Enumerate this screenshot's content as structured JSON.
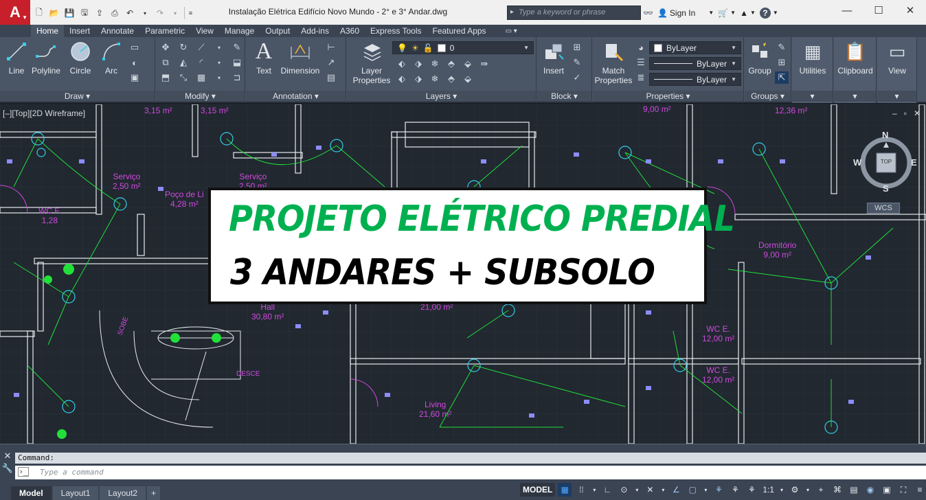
{
  "window": {
    "title": "Instalação Elétrica Edifício Novo Mundo - 2° e 3° Andar.dwg",
    "app_logo": "A",
    "search_placeholder": "Type a keyword or phrase",
    "sign_in": "Sign In",
    "help_icon": "?"
  },
  "ribbon": {
    "tabs": [
      "Home",
      "Insert",
      "Annotate",
      "Parametric",
      "View",
      "Manage",
      "Output",
      "Add-ins",
      "A360",
      "Express Tools",
      "Featured Apps"
    ],
    "active_tab": "Home",
    "panels": {
      "draw": {
        "title": "Draw",
        "buttons": [
          "Line",
          "Polyline",
          "Circle",
          "Arc"
        ]
      },
      "modify": {
        "title": "Modify"
      },
      "annotation": {
        "title": "Annotation",
        "buttons": [
          "Text",
          "Dimension"
        ]
      },
      "layers": {
        "title": "Layers",
        "button": "Layer Properties",
        "current_layer": "0"
      },
      "block": {
        "title": "Block",
        "button": "Insert"
      },
      "properties": {
        "title": "Properties",
        "button": "Match Properties",
        "color": "ByLayer",
        "linetype": "ByLayer",
        "lineweight": "ByLayer"
      },
      "groups": {
        "title": "Groups",
        "button": "Group"
      },
      "utilities": {
        "button": "Utilities"
      },
      "clipboard": {
        "button": "Clipboard"
      },
      "view": {
        "button": "View"
      }
    }
  },
  "viewport": {
    "label": "[–][Top][2D Wireframe]",
    "controls": [
      "–",
      "▫",
      "✕"
    ],
    "viewcube": {
      "north": "N",
      "south": "S",
      "east": "E",
      "west": "W",
      "face": "TOP"
    },
    "wcs": "WCS"
  },
  "drawing": {
    "rooms": [
      {
        "name": "",
        "area": "3,15 m²"
      },
      {
        "name": "",
        "area": "3,15 m²"
      },
      {
        "name": "Serviço",
        "area": "2,50 m²"
      },
      {
        "name": "Poço de Li",
        "area": "4,28 m²"
      },
      {
        "name": "Serviço",
        "area": "2,50 m²"
      },
      {
        "name": "WC F.",
        "area": "1,28"
      },
      {
        "name": "Hall",
        "area": "30,80 m²"
      },
      {
        "name": "",
        "area": "21,00 m²"
      },
      {
        "name": "Living",
        "area": "21,60 m²"
      },
      {
        "name": "",
        "area": "9,00 m²"
      },
      {
        "name": "",
        "area": "12,36 m²"
      },
      {
        "name": "Dormitório",
        "area": "9,00 m²"
      },
      {
        "name": "WC E.",
        "area": "12,00 m²"
      },
      {
        "name": "WC E.",
        "area": "12,00 m²"
      }
    ],
    "labels": {
      "sobe": "SOBE",
      "desce": "DESCE"
    },
    "banner": {
      "line1": "PROJETO ELÉTRICO PREDIAL",
      "line2": "3 ANDARES + SUBSOLO"
    }
  },
  "command": {
    "history": "Command:",
    "placeholder": "Type a command"
  },
  "status": {
    "layout_tabs": [
      "Model",
      "Layout1",
      "Layout2"
    ],
    "active_layout": "Model",
    "model_label": "MODEL",
    "scale": "1:1"
  },
  "colors": {
    "background": "#212830",
    "wire_green": "#21e039",
    "room_text": "#d04adf",
    "symbol_cyan": "#33cfe6",
    "label_blue": "#8c8cf7",
    "banner_green": "#00b050"
  }
}
